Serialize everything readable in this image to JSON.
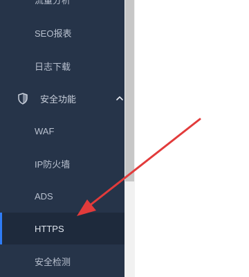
{
  "sidebar": {
    "items": [
      {
        "label": "流量分析"
      },
      {
        "label": "SEO报表"
      },
      {
        "label": "日志下载"
      },
      {
        "label": "安全功能",
        "icon": "shield-icon",
        "expanded": true
      },
      {
        "label": "WAF"
      },
      {
        "label": "IP防火墙"
      },
      {
        "label": "ADS"
      },
      {
        "label": "HTTPS",
        "active": true
      },
      {
        "label": "安全检测"
      }
    ]
  },
  "colors": {
    "sidebar_bg": "#263449",
    "active_bg": "#1e2a3c",
    "active_marker": "#2f7cf6",
    "annotation_arrow": "#e23b3b"
  },
  "annotation": {
    "icon": "red-arrow-pointing-to-https"
  }
}
